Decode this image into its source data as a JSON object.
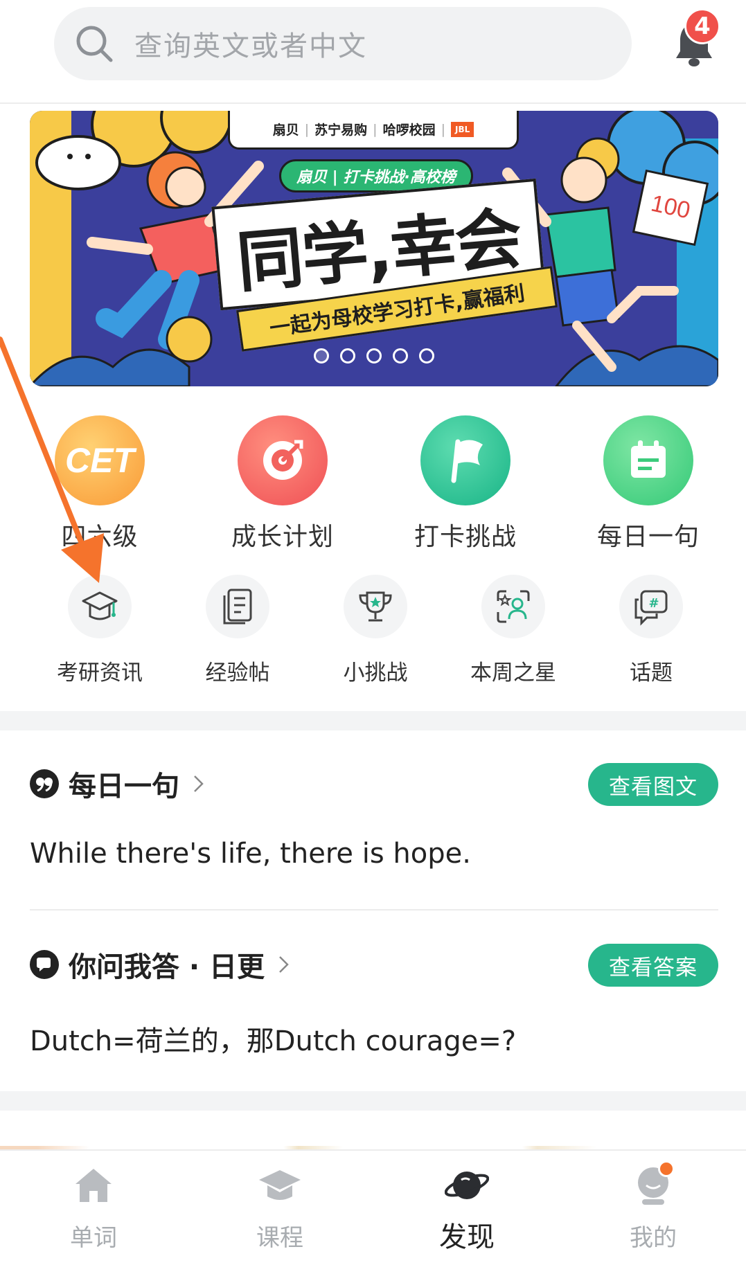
{
  "search": {
    "placeholder": "查询英文或者中文"
  },
  "notifications": {
    "badge_count": "4"
  },
  "banner": {
    "sponsors": [
      "扇贝",
      "苏宁易购",
      "哈啰校园",
      "JBL"
    ],
    "tag": "扇贝 | 打卡挑战·高校榜",
    "title": "同学,幸会",
    "subtitle": "一起为母校学习打卡,赢福利",
    "score_card": "100",
    "dots_total": 5,
    "dots_active_index": 0
  },
  "primary_grid": [
    {
      "label": "四六级",
      "icon": "cet-icon",
      "badge_text": "CET",
      "color": "#f9a13a"
    },
    {
      "label": "成长计划",
      "icon": "target-icon",
      "color": "#f15f5a"
    },
    {
      "label": "打卡挑战",
      "icon": "flag-icon",
      "color": "#22c08a"
    },
    {
      "label": "每日一句",
      "icon": "calendar-icon",
      "color": "#3fd07c"
    }
  ],
  "secondary_grid": [
    {
      "label": "考研资讯",
      "icon": "graduation-cap-icon"
    },
    {
      "label": "经验帖",
      "icon": "document-icon"
    },
    {
      "label": "小挑战",
      "icon": "trophy-icon"
    },
    {
      "label": "本周之星",
      "icon": "star-person-icon"
    },
    {
      "label": "话题",
      "icon": "hashtag-chat-icon"
    }
  ],
  "daily_sentence": {
    "title": "每日一句",
    "button": "查看图文",
    "text": "While there's life, there is hope."
  },
  "qa": {
    "title": "你问我答 · 日更",
    "button": "查看答案",
    "text": "Dutch=荷兰的，那Dutch courage=?"
  },
  "bottom_nav": [
    {
      "label": "单词",
      "icon": "home-icon",
      "active": false
    },
    {
      "label": "课程",
      "icon": "graduation-cap-icon",
      "active": false
    },
    {
      "label": "发现",
      "icon": "planet-icon",
      "active": true
    },
    {
      "label": "我的",
      "icon": "profile-icon",
      "active": false
    }
  ],
  "colors": {
    "accent_green": "#27b68c",
    "badge_red": "#f0504a",
    "annotation_orange": "#f5732c",
    "banner_blue": "#3b3f9c"
  }
}
